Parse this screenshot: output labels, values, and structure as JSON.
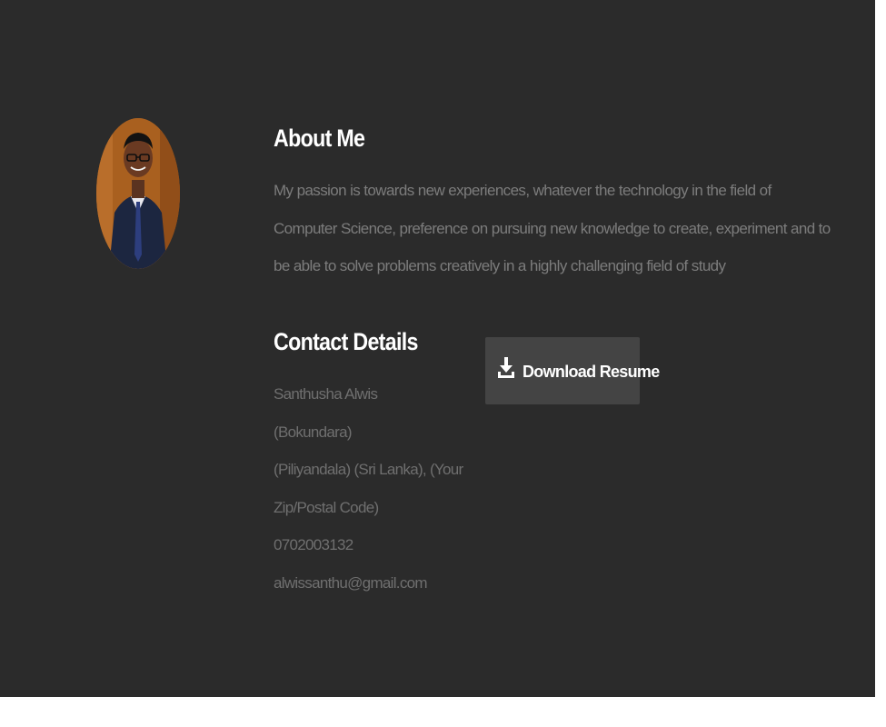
{
  "colors": {
    "section_background": "#2b2b2b",
    "page_background": "#ffffff",
    "heading": "#ffffff",
    "body_text": "#7c7c7c",
    "button_background": "#444444",
    "button_text": "#ffffff"
  },
  "about": {
    "heading": "About Me",
    "text": "My passion is towards new experiences, whatever the technology in the field of Computer Science, preference on pursuing new knowledge to create, experiment and to be able to solve problems creatively in a highly challenging field of study"
  },
  "contact": {
    "heading": "Contact Details",
    "items": [
      "Santhusha Alwis",
      "(Bokundara)",
      "(Piliyandala) (Sri Lanka), (Your",
      "Zip/Postal Code)",
      "0702003132",
      "alwissanthu@gmail.com"
    ]
  },
  "download": {
    "label": "Download Resume",
    "icon": "download-icon"
  },
  "profile": {
    "image": "profile-photo"
  }
}
